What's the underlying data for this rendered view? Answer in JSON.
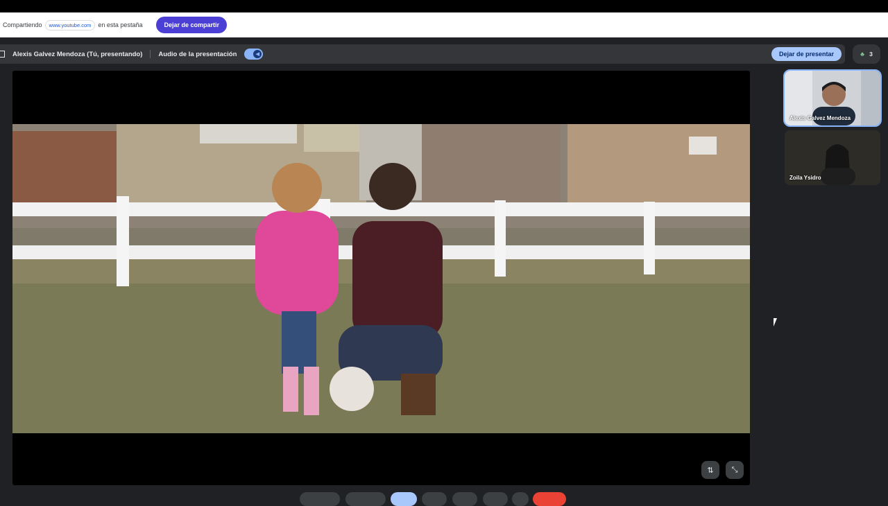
{
  "share_bar": {
    "sharing_prefix": "Compartiendo",
    "url": "www.youtube.com",
    "sharing_suffix": "en esta pestaña",
    "stop_sharing_label": "Dejar de compartir"
  },
  "presentation_bar": {
    "presenter": "Alexis Galvez Mendoza (Tú, presentando)",
    "audio_label": "Audio de la presentación",
    "audio_enabled": true,
    "stop_presenting_label": "Dejar de presentar"
  },
  "people": {
    "count": "3",
    "icon": "people-icon"
  },
  "participants": [
    {
      "name": "Alexis Galvez Mendoza",
      "active": true
    },
    {
      "name": "Zoila Ysidro",
      "active": false
    }
  ],
  "stage_controls": {
    "swap_icon": "swap-vert-icon",
    "minimize_icon": "collapse-icon"
  },
  "colors": {
    "accent": "#4b3fd6",
    "stop_presenting_bg": "#a8c7fa",
    "meet_bg": "#202124",
    "people_icon": "#81c995"
  }
}
